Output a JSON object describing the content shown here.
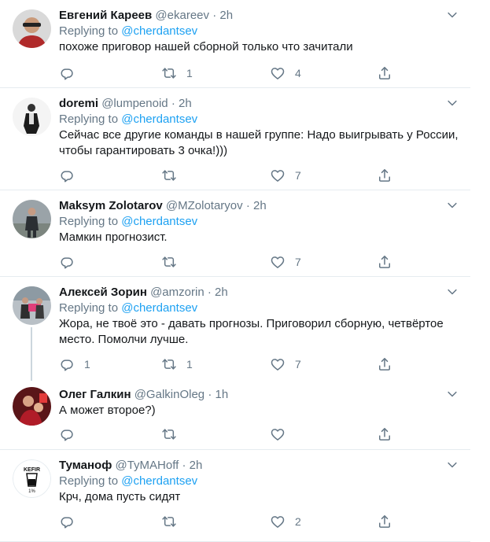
{
  "reply_prefix": "Replying to",
  "colors": {
    "link": "#1da1f2",
    "secondary": "#657786",
    "text": "#14171a",
    "border": "#e6ecf0",
    "thread_line": "#ccd6dd"
  },
  "tweets": [
    {
      "name": "Евгений Кареев",
      "handle": "@ekareev",
      "dot": "·",
      "time": "2h",
      "reply_to": "@cherdantsev",
      "text": "похоже приговор нашей сборной только что зачитали",
      "replies": "",
      "retweets": "1",
      "likes": "4"
    },
    {
      "name": "doremi",
      "handle": "@lumpenoid",
      "dot": "·",
      "time": "2h",
      "reply_to": "@cherdantsev",
      "text_lines": [
        "Сейчас все другие команды в нашей группе: Надо выигрывать у России,",
        "чтобы гарантировать 3 очка!)))"
      ],
      "replies": "",
      "retweets": "",
      "likes": "7"
    },
    {
      "name": "Maksym Zolotarov",
      "handle": "@MZolotaryov",
      "dot": "·",
      "time": "2h",
      "reply_to": "@cherdantsev",
      "text": "Мамкин прогнозист.",
      "replies": "",
      "retweets": "",
      "likes": "7"
    },
    {
      "name": "Алексей Зорин",
      "handle": "@amzorin",
      "dot": "·",
      "time": "2h",
      "reply_to": "@cherdantsev",
      "text_lines": [
        "Жора, не твоё это - давать прогнозы. Приговорил сборную, четвёртое",
        "место. Помолчи лучше."
      ],
      "replies": "1",
      "retweets": "1",
      "likes": "7"
    },
    {
      "name": "Олег Галкин",
      "handle": "@GalkinOleg",
      "dot": "·",
      "time": "1h",
      "text": "А может второе?)",
      "replies": "",
      "retweets": "",
      "likes": ""
    },
    {
      "name": "Туманоф",
      "handle": "@TyMAHoff",
      "dot": "·",
      "time": "2h",
      "reply_to": "@cherdantsev",
      "text": "Крч, дома пусть сидят",
      "replies": "",
      "retweets": "",
      "likes": "2",
      "avatar_text": {
        "top": "KEFIR",
        "bottom": "1%"
      }
    }
  ],
  "icons": {
    "reply": "reply-icon",
    "retweet": "retweet-icon",
    "like": "heart-icon",
    "share": "share-icon",
    "menu": "chevron-down-icon"
  }
}
